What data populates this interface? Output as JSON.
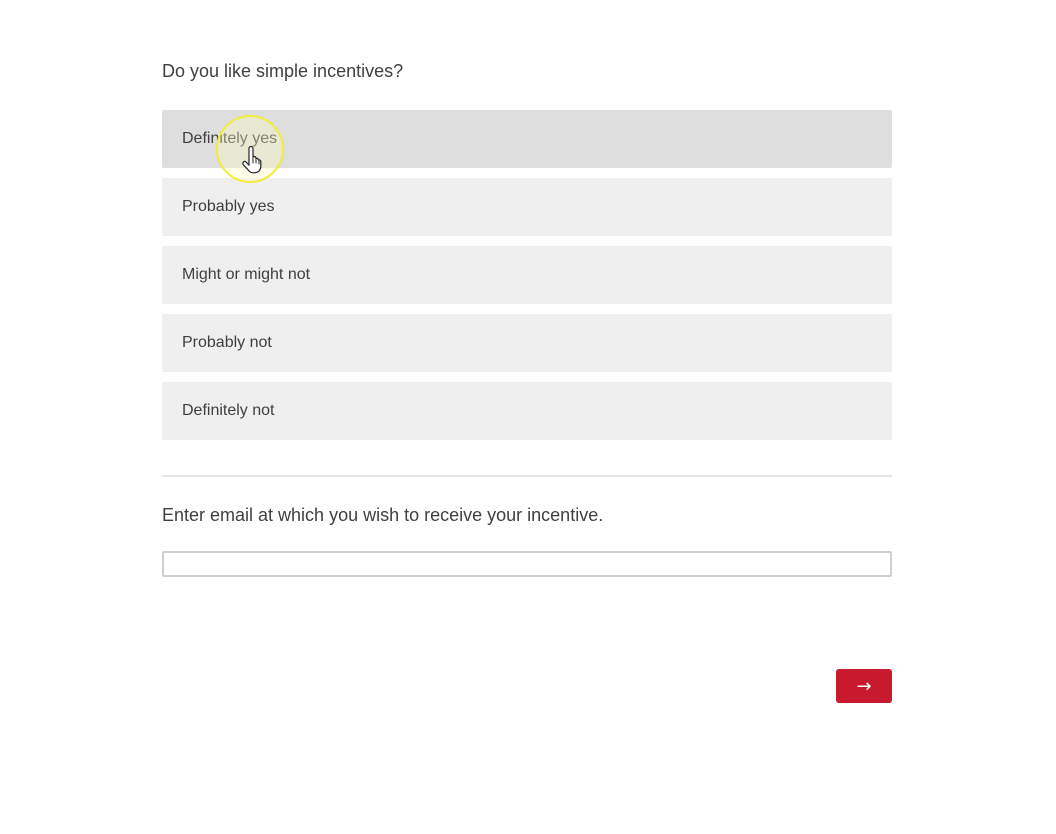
{
  "question": {
    "text": "Do you like simple incentives?",
    "choices": [
      {
        "label": "Definitely yes",
        "hovered": true
      },
      {
        "label": "Probably yes",
        "hovered": false
      },
      {
        "label": "Might or might not",
        "hovered": false
      },
      {
        "label": "Probably not",
        "hovered": false
      },
      {
        "label": "Definitely not",
        "hovered": false
      }
    ]
  },
  "email": {
    "label": "Enter email at which you wish to receive your incentive.",
    "value": ""
  },
  "navigation": {
    "next_label": "→"
  },
  "colors": {
    "accent": "#c8192e",
    "choice_bg": "#efefef",
    "choice_hover_bg": "#dedede",
    "cursor_highlight": "#f2ec3a"
  },
  "cursor": {
    "icon": "hand-pointer-icon"
  }
}
